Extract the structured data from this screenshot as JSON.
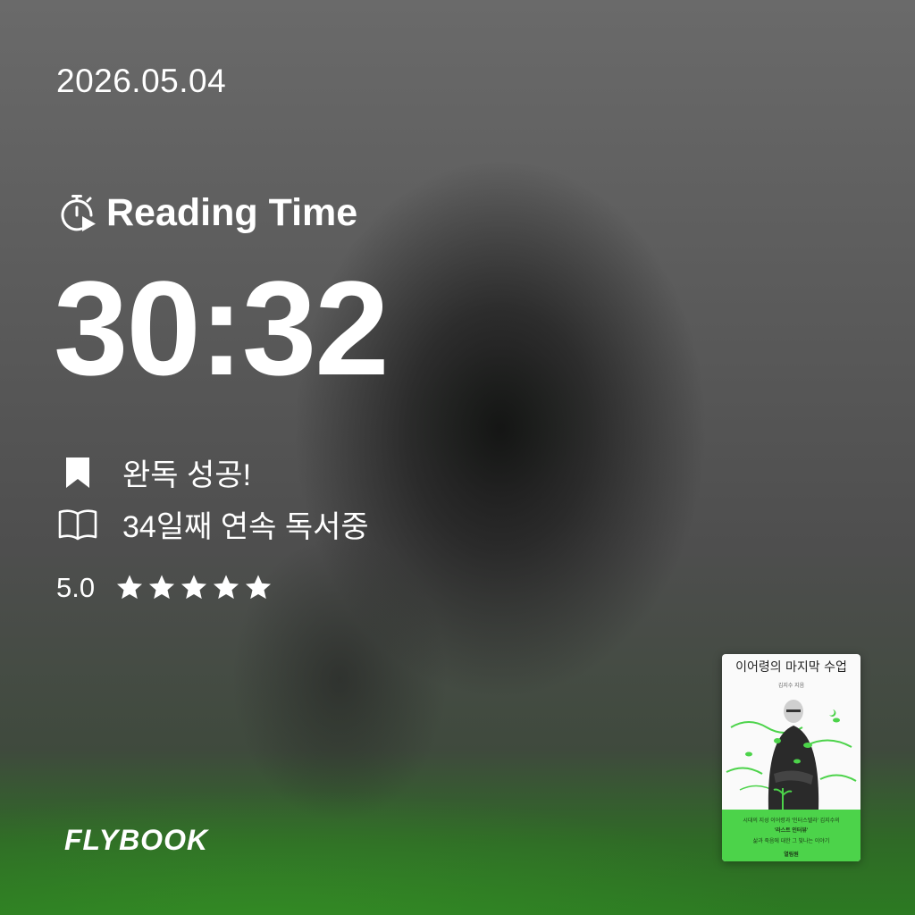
{
  "date": "2026.05.04",
  "reading_time": {
    "label": "Reading Time",
    "value": "30:32"
  },
  "stats": {
    "completed": "완독 성공!",
    "streak": "34일째 연속 독서중"
  },
  "rating": {
    "value": "5.0",
    "stars": 5,
    "max": 5
  },
  "brand": "FLYBOOK",
  "book": {
    "title": "이어령의 마지막 수업",
    "author": "김지수 지음",
    "band_line1": "시대의 지성 이어령과 '인터스텔라' 김지수의",
    "band_line2": "'라스트 인터뷰'",
    "band_line3": "삶과 죽음에 대한 그 빛나는 이야기",
    "publisher": "열림원"
  },
  "icons": {
    "timer": "stopwatch-play-icon",
    "completed": "bookmark-icon",
    "streak": "open-book-icon",
    "star": "star-icon"
  },
  "colors": {
    "text": "#ffffff",
    "accent_green": "#4cd34a"
  }
}
